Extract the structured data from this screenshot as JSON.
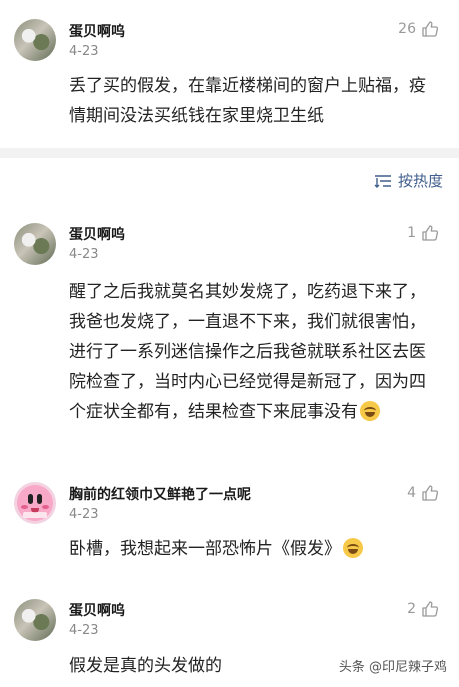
{
  "comments": [
    {
      "username": "蛋贝啊呜",
      "date": "4-23",
      "likes": "26",
      "text": "丢了买的假发，在靠近楼梯间的窗户上贴福，疫情期间没法买纸钱在家里烧卫生纸"
    },
    {
      "username": "蛋贝啊呜",
      "date": "4-23",
      "likes": "1",
      "text": "醒了之后我就莫名其妙发烧了，吃药退下来了，我爸也发烧了，一直退不下来，我们就很害怕，进行了一系列迷信操作之后我爸就联系社区去医院检查了，当时内心已经觉得是新冠了，因为四个症状全都有，结果检查下来屁事没有"
    },
    {
      "username": "胸前的红领巾又鲜艳了一点呢",
      "date": "4-23",
      "likes": "4",
      "text": "卧槽，我想起来一部恐怖片《假发》"
    },
    {
      "username": "蛋贝啊呜",
      "date": "4-23",
      "likes": "2",
      "text": "假发是真的头发做的"
    }
  ],
  "sort": {
    "label": "按热度",
    "icon": "sort-icon"
  },
  "watermark": "头条 @印尼辣子鸡",
  "icons": {
    "like": "thumbs-up-icon",
    "emoji": "laughing-crying-emoji"
  },
  "colors": {
    "accent": "#405f8c",
    "muted": "#999999",
    "divider": "#f2f2f2"
  }
}
